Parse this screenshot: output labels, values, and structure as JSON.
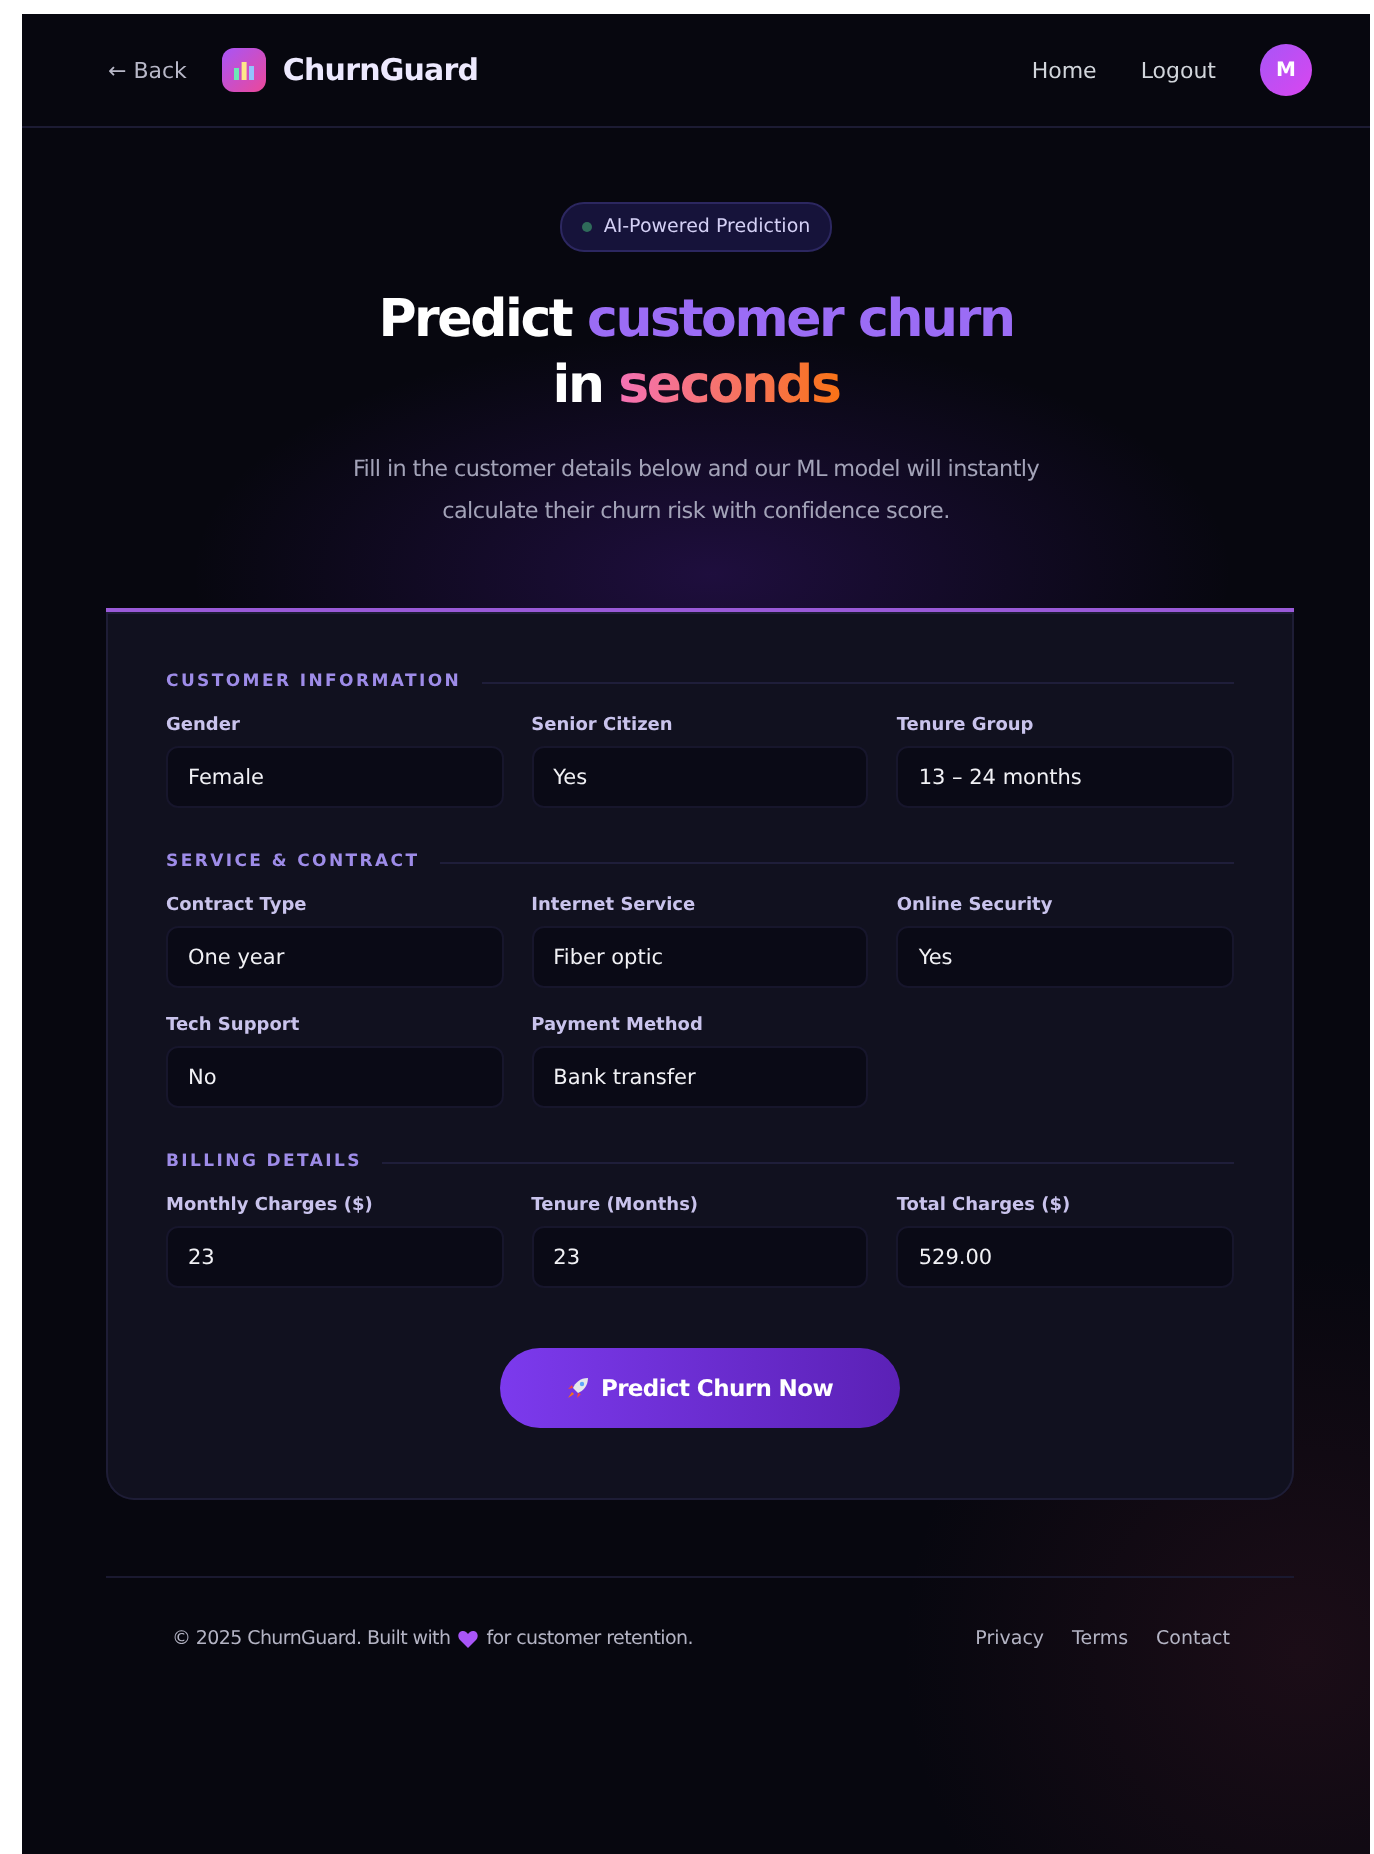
{
  "nav": {
    "back": "← Back",
    "brand": "ChurnGuard",
    "links": [
      "Home",
      "Logout"
    ],
    "avatar": "M"
  },
  "hero": {
    "badge": "AI-Powered Prediction",
    "title_lines": [
      [
        {
          "text": "Predict",
          "kind": "plain"
        },
        {
          "text": "customer churn",
          "kind": "violet"
        }
      ],
      [
        {
          "text": "in",
          "kind": "plain"
        },
        {
          "text": "seconds",
          "kind": "warm"
        }
      ]
    ],
    "subtitle": "Fill in the customer details below and our ML model will instantly calculate their churn risk with confidence score."
  },
  "sections": [
    {
      "title": "CUSTOMER INFORMATION",
      "fields": [
        {
          "label": "Gender",
          "value": "Female"
        },
        {
          "label": "Senior Citizen",
          "value": "Yes"
        },
        {
          "label": "Tenure Group",
          "value": "13 – 24 months"
        }
      ]
    },
    {
      "title": "SERVICE & CONTRACT",
      "fields": [
        {
          "label": "Contract Type",
          "value": "One year"
        },
        {
          "label": "Internet Service",
          "value": "Fiber optic"
        },
        {
          "label": "Online Security",
          "value": "Yes"
        },
        {
          "label": "Tech Support",
          "value": "No"
        },
        {
          "label": "Payment Method",
          "value": "Bank transfer"
        }
      ]
    },
    {
      "title": "BILLING DETAILS",
      "fields": [
        {
          "label": "Monthly Charges ($)",
          "value": "23"
        },
        {
          "label": "Tenure (Months)",
          "value": "23"
        },
        {
          "label": "Total Charges ($)",
          "value": "529.00"
        }
      ]
    }
  ],
  "submit": "Predict Churn Now",
  "footer": {
    "text_before": "© 2025 ChurnGuard. Built with",
    "text_after": "for customer retention.",
    "links": [
      "Privacy",
      "Terms",
      "Contact"
    ]
  }
}
